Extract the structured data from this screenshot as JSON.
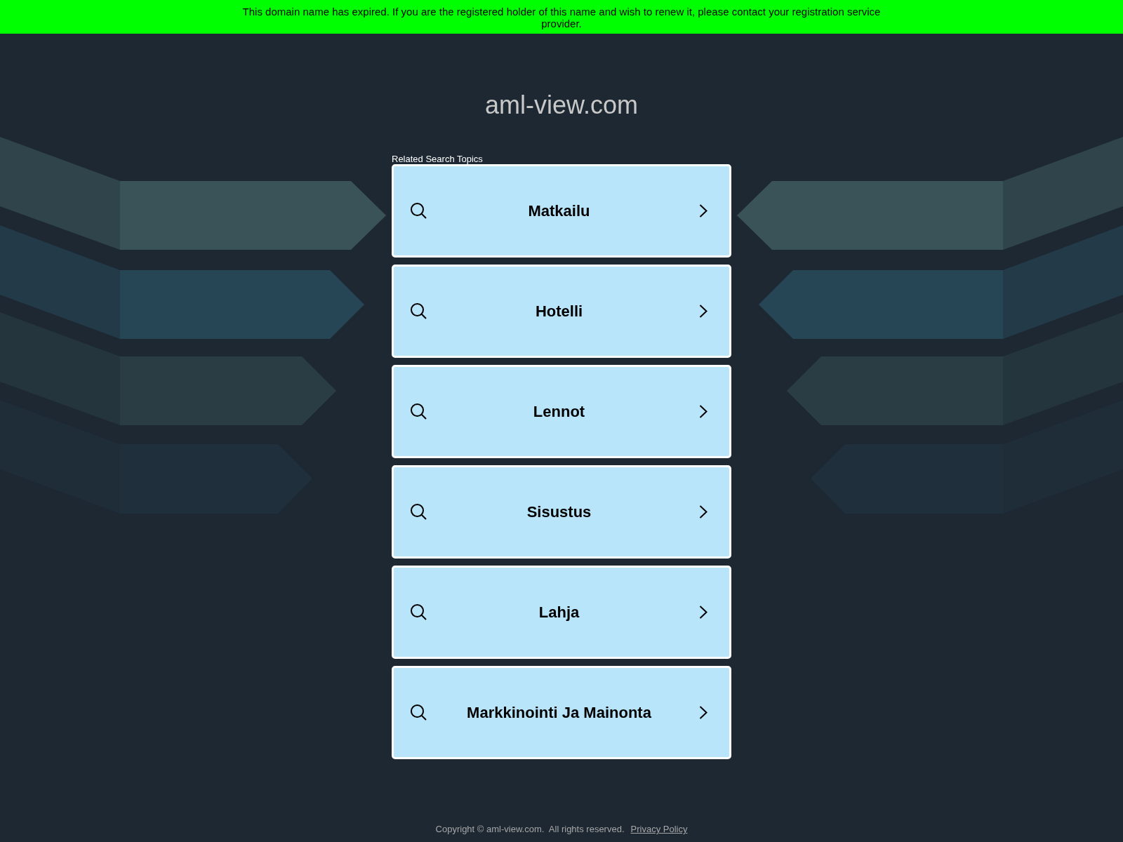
{
  "expiry_banner": {
    "text": "This domain name has expired. If you are the registered holder of this name and wish to renew it, please contact your registration service provider."
  },
  "site_title": "aml-view.com",
  "related_searches": {
    "heading": "Related Search Topics",
    "topics": [
      {
        "label": "Matkailu"
      },
      {
        "label": "Hotelli"
      },
      {
        "label": "Lennot"
      },
      {
        "label": "Sisustus"
      },
      {
        "label": "Lahja"
      },
      {
        "label": "Markkinointi Ja Mainonta"
      }
    ]
  },
  "footer": {
    "copyright": "Copyright © aml-view.com.  All rights reserved.",
    "privacy_link": "Privacy Policy"
  }
}
